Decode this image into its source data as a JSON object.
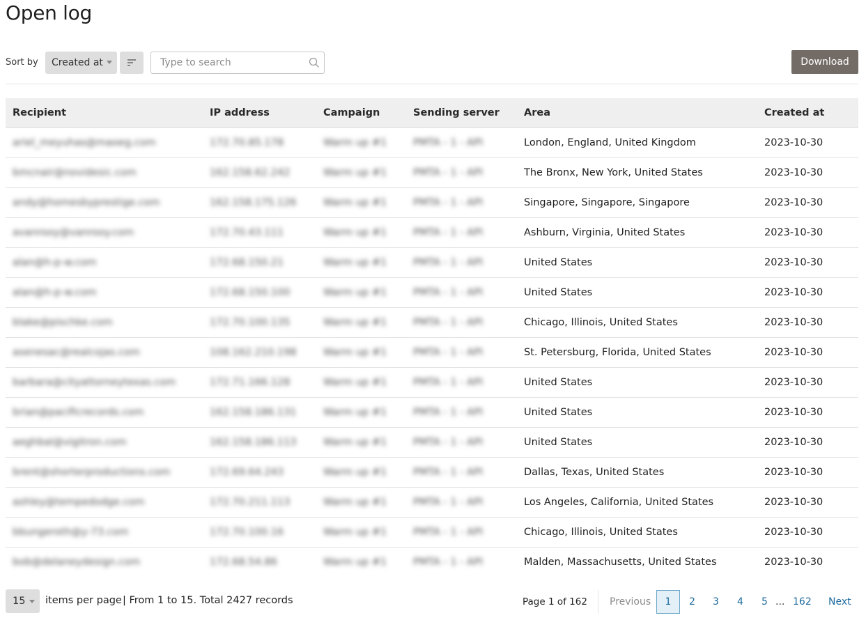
{
  "page": {
    "title": "Open log"
  },
  "toolbar": {
    "sort_label": "Sort by",
    "sort_value": "Created at",
    "search_placeholder": "Type to search",
    "download_label": "Download"
  },
  "table": {
    "columns": [
      "Recipient",
      "IP address",
      "Campaign",
      "Sending server",
      "Area",
      "Created at"
    ],
    "rows": [
      [
        "ariel_meyuhas@maoeg.com",
        "172.70.85.178",
        "Warm up #1",
        "PMTA - 1 - API",
        "London, England, United Kingdom",
        "2023-10-30"
      ],
      [
        "bmcnair@novidesic.com",
        "162.158.62.242",
        "Warm up #1",
        "PMTA - 1 - API",
        "The Bronx, New York, United States",
        "2023-10-30"
      ],
      [
        "andy@homesbyprestige.com",
        "162.158.175.126",
        "Warm up #1",
        "PMTA - 1 - API",
        "Singapore, Singapore, Singapore",
        "2023-10-30"
      ],
      [
        "avanrooy@vanrooy.com",
        "172.70.43.111",
        "Warm up #1",
        "PMTA - 1 - API",
        "Ashburn, Virginia, United States",
        "2023-10-30"
      ],
      [
        "alan@h-p-w.com",
        "172.68.150.21",
        "Warm up #1",
        "PMTA - 1 - API",
        "United States",
        "2023-10-30"
      ],
      [
        "alan@h-p-w.com",
        "172.68.150.100",
        "Warm up #1",
        "PMTA - 1 - API",
        "United States",
        "2023-10-30"
      ],
      [
        "blake@pischke.com",
        "172.70.100.135",
        "Warm up #1",
        "PMTA - 1 - API",
        "Chicago, Illinois, United States",
        "2023-10-30"
      ],
      [
        "asenesac@realcojas.com",
        "108.162.210.198",
        "Warm up #1",
        "PMTA - 1 - API",
        "St. Petersburg, Florida, United States",
        "2023-10-30"
      ],
      [
        "barbara@cityattorneytexas.com",
        "172.71.166.128",
        "Warm up #1",
        "PMTA - 1 - API",
        "United States",
        "2023-10-30"
      ],
      [
        "brian@pacificrecords.com",
        "162.158.186.131",
        "Warm up #1",
        "PMTA - 1 - API",
        "United States",
        "2023-10-30"
      ],
      [
        "aeghbal@vigitron.com",
        "162.158.186.113",
        "Warm up #1",
        "PMTA - 1 - API",
        "United States",
        "2023-10-30"
      ],
      [
        "brent@shorterproductions.com",
        "172.69.64.243",
        "Warm up #1",
        "PMTA - 1 - API",
        "Dallas, Texas, United States",
        "2023-10-30"
      ],
      [
        "ashley@tempedodge.com",
        "172.70.211.113",
        "Warm up #1",
        "PMTA - 1 - API",
        "Los Angeles, California, United States",
        "2023-10-30"
      ],
      [
        "bbungeroth@y-73.com",
        "172.70.100.16",
        "Warm up #1",
        "PMTA - 1 - API",
        "Chicago, Illinois, United States",
        "2023-10-30"
      ],
      [
        "bob@delaneydesign.com",
        "172.68.54.86",
        "Warm up #1",
        "PMTA - 1 - API",
        "Malden, Massachusetts, United States",
        "2023-10-30"
      ]
    ]
  },
  "footer": {
    "per_page_value": "15",
    "per_page_label": "items per page",
    "range_text": "| From 1 to 15. Total 2427 records",
    "page_info": "Page 1 of 162",
    "previous_label": "Previous",
    "pages": [
      "1",
      "2",
      "3",
      "4",
      "5"
    ],
    "ellipsis": "...",
    "last_page": "162",
    "next_label": "Next",
    "active_page": "1"
  },
  "colors": {
    "download_bg": "#736c66",
    "header_bg": "#efefef",
    "link": "#1e6b9e",
    "active_page_bg": "#e3f0f7"
  },
  "icons": {
    "sort_order": "sort-lines-icon",
    "search": "search-icon",
    "dropdown": "caret-down-icon"
  }
}
